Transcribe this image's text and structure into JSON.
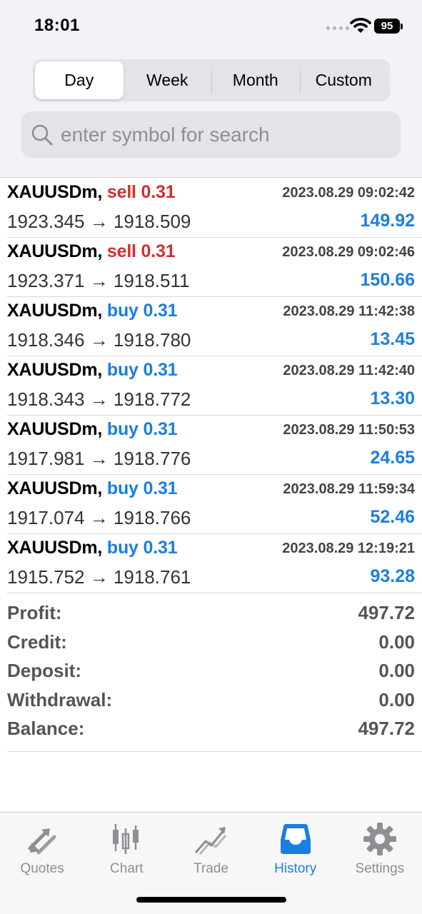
{
  "status_bar": {
    "time": "18:01",
    "battery": "95"
  },
  "period_tabs": [
    {
      "label": "Day",
      "active": true
    },
    {
      "label": "Week",
      "active": false
    },
    {
      "label": "Month",
      "active": false
    },
    {
      "label": "Custom",
      "active": false
    }
  ],
  "search": {
    "placeholder": "enter symbol for search",
    "value": ""
  },
  "deals": [
    {
      "symbol": "XAUUSDm,",
      "action": "sell 0.31",
      "type": "sell",
      "time": "2023.08.29 09:02:42",
      "open_price": "1923.345",
      "close_price": "1918.509",
      "profit": "149.92"
    },
    {
      "symbol": "XAUUSDm,",
      "action": "sell 0.31",
      "type": "sell",
      "time": "2023.08.29 09:02:46",
      "open_price": "1923.371",
      "close_price": "1918.511",
      "profit": "150.66"
    },
    {
      "symbol": "XAUUSDm,",
      "action": "buy 0.31",
      "type": "buy",
      "time": "2023.08.29 11:42:38",
      "open_price": "1918.346",
      "close_price": "1918.780",
      "profit": "13.45"
    },
    {
      "symbol": "XAUUSDm,",
      "action": "buy 0.31",
      "type": "buy",
      "time": "2023.08.29 11:42:40",
      "open_price": "1918.343",
      "close_price": "1918.772",
      "profit": "13.30"
    },
    {
      "symbol": "XAUUSDm,",
      "action": "buy 0.31",
      "type": "buy",
      "time": "2023.08.29 11:50:53",
      "open_price": "1917.981",
      "close_price": "1918.776",
      "profit": "24.65"
    },
    {
      "symbol": "XAUUSDm,",
      "action": "buy 0.31",
      "type": "buy",
      "time": "2023.08.29 11:59:34",
      "open_price": "1917.074",
      "close_price": "1918.766",
      "profit": "52.46"
    },
    {
      "symbol": "XAUUSDm,",
      "action": "buy 0.31",
      "type": "buy",
      "time": "2023.08.29 12:19:21",
      "open_price": "1915.752",
      "close_price": "1918.761",
      "profit": "93.28"
    }
  ],
  "summary": [
    {
      "label": "Profit:",
      "value": "497.72"
    },
    {
      "label": "Credit:",
      "value": "0.00"
    },
    {
      "label": "Deposit:",
      "value": "0.00"
    },
    {
      "label": "Withdrawal:",
      "value": "0.00"
    },
    {
      "label": "Balance:",
      "value": "497.72"
    }
  ],
  "tab_bar": [
    {
      "label": "Quotes",
      "icon": "quotes-icon",
      "active": false
    },
    {
      "label": "Chart",
      "icon": "chart-icon",
      "active": false
    },
    {
      "label": "Trade",
      "icon": "trade-icon",
      "active": false
    },
    {
      "label": "History",
      "icon": "history-icon",
      "active": true
    },
    {
      "label": "Settings",
      "icon": "settings-icon",
      "active": false
    }
  ],
  "colors": {
    "accent": "#1a7fe0",
    "sell": "#d0312d",
    "inactive_tab": "#8e8e93"
  }
}
